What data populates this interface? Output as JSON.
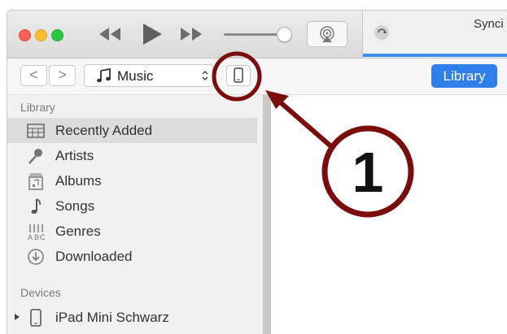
{
  "toolbar": {
    "icons": [
      "rewind-icon",
      "play-icon",
      "fast-forward-icon",
      "airplay-icon"
    ],
    "status": {
      "text": "Synci"
    }
  },
  "nav": {
    "back_label": "<",
    "forward_label": ">",
    "media_kind": "Music",
    "library_label": "Library"
  },
  "sidebar": {
    "library_header": "Library",
    "items": [
      {
        "label": "Recently Added",
        "icon": "recently-added-icon",
        "selected": true
      },
      {
        "label": "Artists",
        "icon": "microphone-icon"
      },
      {
        "label": "Albums",
        "icon": "album-icon"
      },
      {
        "label": "Songs",
        "icon": "music-note-icon"
      },
      {
        "label": "Genres",
        "icon": "genres-icon"
      },
      {
        "label": "Downloaded",
        "icon": "download-icon"
      }
    ],
    "devices_header": "Devices",
    "devices": [
      {
        "label": "iPad Mini Schwarz",
        "icon": "ipad-icon"
      }
    ]
  },
  "annotation": {
    "number": "1"
  },
  "colors": {
    "accent": "#2f7fea",
    "annotation": "#7a0c0c"
  }
}
